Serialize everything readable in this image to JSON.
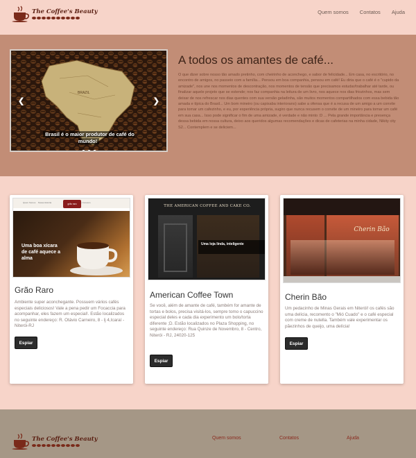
{
  "brand": {
    "name": "The Coffee's Beauty"
  },
  "nav": {
    "items": [
      "Quem somos",
      "Contatos",
      "Ajuda"
    ]
  },
  "carousel": {
    "caption": "Brasil é o maior produtor de café do mundo!",
    "prev_icon": "chevron-left-icon",
    "next_icon": "chevron-right-icon",
    "slide_count": 3,
    "active_slide": 1
  },
  "hero": {
    "title": "A todos os amantes de café...",
    "text": "O que dizer sobre nosso tão amado pretinho, com cheirinho de aconchego, e sabor de felicidade... Em casa, no escritório, no encontro de amigos, no passeio com a família... Pensou em boa companhia, pensou em café! Eu diria que o café é o \"cupido da amizade\", nos une nos momentos de descontração, nos momentos de tensão que precisamos estudar/trabalhar até tarde, ou finalizar aquele projeto que se estende; nos faz companhia na leitura de um livro, nos aquece nos dias friozinhos, mas sem deixar de nos refrescar nos dias quentes com sua versão geladinha, são muitos momentos compartilhados com essa bebida tão amada e típica do Brasil... Um bom mineiro (ou capixaba interiorano) sabe a ofensa que é a recusa de um amigo a um convite para tomar um cafezinho, e eu, por experiência própria, sugiro que nunca recusem o convite de um mineiro para tomar um café em sua casa... Isso pode significar o fim de uma amizade, é verdade e não minto :D ... Pela grande importância e presença dessa bebida em nossa cultura, deixo aos queridos algumas recomendações e dicas de cafeterias na minha cidade, Nikity city S2... Contemplem e se deliciem..."
  },
  "cards": [
    {
      "title": "Grão Raro",
      "text": "Ambiente super aconchegante. Possuem vários cafés especiais deliciosos! Vale a pena pedir um Focaccia para acompanhar, eles fazem um especial!. Estão localizados no seguinte endereço: R. Otávio Carneiro, 8 - lj 4,Icaraí - Niterói-RJ",
      "button": "Espiar",
      "image": {
        "nav_links": [
          "Quem Somos",
          "Nossa História",
          "Menu Online",
          "Fale Conosco"
        ],
        "logo": "grão raro",
        "overlay": "Uma boa xícara de café aquece a alma"
      }
    },
    {
      "title": "American Coffee Town",
      "text": "Se você, além de amante de café, também for amante de tortas e bolos, precisa visitá-los, sempre tomo o capuccino especial deles e cada dia experimento um bolo/torta diferente ;D. Estão localizados no Plaza Shopping, no seguinte endereço: Rua Quinze de Novembro, 8 - Centro, Niterói - RJ, 24020-125",
      "button": "Espiar",
      "image": {
        "sign": "THE AMERICAN COFFEE AND CAKE CO.",
        "overlay": "Uma loja linda, inteligente"
      }
    },
    {
      "title": "Cherin Bão",
      "text": "Um pedacinho de Minas Gerais em Niterói! os cafés são uma delícia, recomento o \"Mió Cuado\" e o café especial com creme de nutella. Também vale experimentar os pãezinhos de queijo, uma delícia!",
      "button": "Espiar",
      "image": {
        "sign": "Cherin Bão"
      }
    }
  ],
  "footer": {
    "brand": "The Coffee's Beauty",
    "nav_items": [
      "Quem somos",
      "Contatos",
      "Ajuda"
    ]
  },
  "colors": {
    "page_bg": "#f7d4c9",
    "hero_bg": "#c28d76",
    "footer_bg": "#a59786",
    "button_bg": "#2c2c2c",
    "footer_link": "#8a2a1e"
  }
}
